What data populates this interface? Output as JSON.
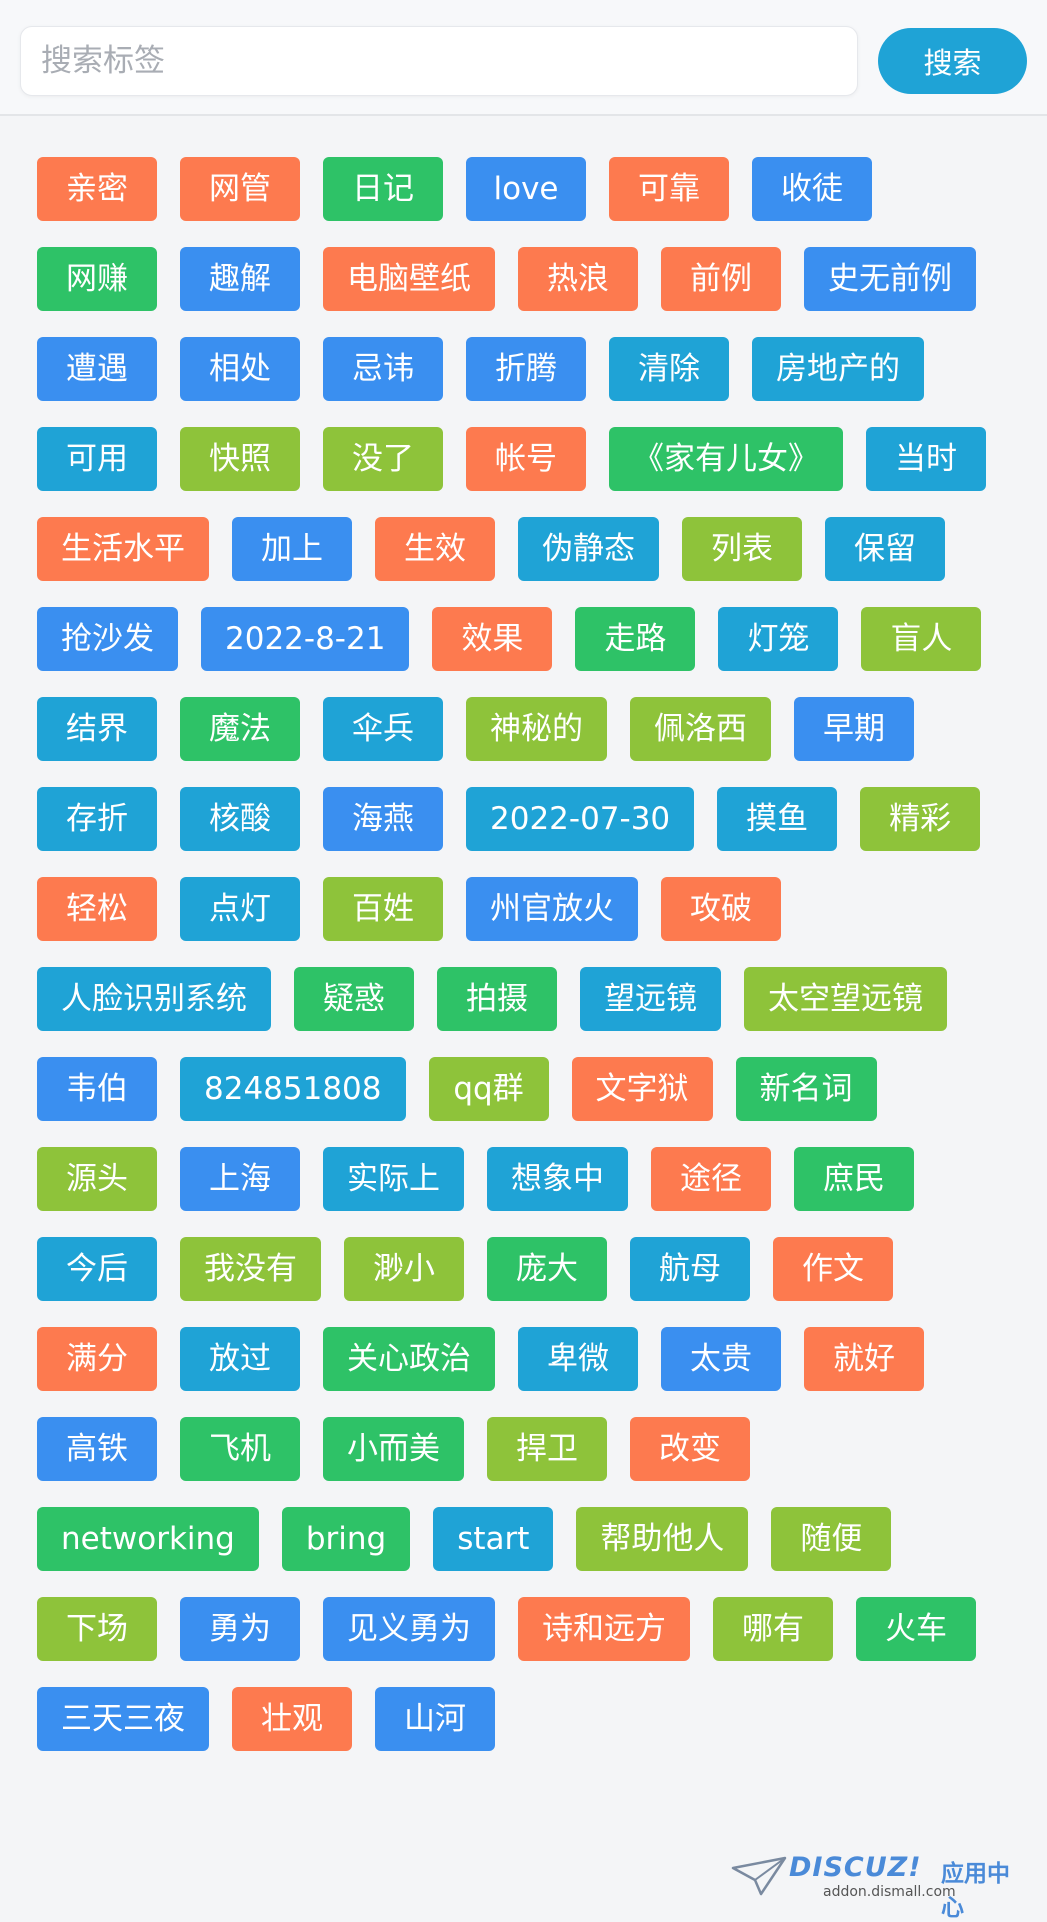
{
  "search": {
    "placeholder": "搜索标签",
    "button_label": "搜索"
  },
  "colors": {
    "orange": "#fd7a4f",
    "green": "#2ec267",
    "blue": "#3a8ff0",
    "teal": "#1fa3d6",
    "lime": "#8ec33a"
  },
  "tags": [
    {
      "label": "亲密",
      "color": "orange"
    },
    {
      "label": "网管",
      "color": "orange"
    },
    {
      "label": "日记",
      "color": "green"
    },
    {
      "label": "love",
      "color": "blue"
    },
    {
      "label": "可靠",
      "color": "orange"
    },
    {
      "label": "收徒",
      "color": "blue"
    },
    {
      "label": "网赚",
      "color": "green"
    },
    {
      "label": "趣解",
      "color": "blue"
    },
    {
      "label": "电脑壁纸",
      "color": "orange"
    },
    {
      "label": "热浪",
      "color": "orange"
    },
    {
      "label": "前例",
      "color": "orange"
    },
    {
      "label": "史无前例",
      "color": "blue"
    },
    {
      "label": "遭遇",
      "color": "blue"
    },
    {
      "label": "相处",
      "color": "blue"
    },
    {
      "label": "忌讳",
      "color": "blue"
    },
    {
      "label": "折腾",
      "color": "blue"
    },
    {
      "label": "清除",
      "color": "teal"
    },
    {
      "label": "房地产的",
      "color": "teal"
    },
    {
      "label": "可用",
      "color": "teal"
    },
    {
      "label": "快照",
      "color": "lime"
    },
    {
      "label": "没了",
      "color": "lime"
    },
    {
      "label": "帐号",
      "color": "orange"
    },
    {
      "label": "《家有儿女》",
      "color": "green"
    },
    {
      "label": "当时",
      "color": "teal"
    },
    {
      "label": "生活水平",
      "color": "orange"
    },
    {
      "label": "加上",
      "color": "blue"
    },
    {
      "label": "生效",
      "color": "orange"
    },
    {
      "label": "伪静态",
      "color": "teal"
    },
    {
      "label": "列表",
      "color": "lime"
    },
    {
      "label": "保留",
      "color": "teal"
    },
    {
      "label": "抢沙发",
      "color": "blue"
    },
    {
      "label": "2022-8-21",
      "color": "blue"
    },
    {
      "label": "效果",
      "color": "orange"
    },
    {
      "label": "走路",
      "color": "green"
    },
    {
      "label": "灯笼",
      "color": "teal"
    },
    {
      "label": "盲人",
      "color": "lime"
    },
    {
      "label": "结界",
      "color": "teal"
    },
    {
      "label": "魔法",
      "color": "green"
    },
    {
      "label": "伞兵",
      "color": "teal"
    },
    {
      "label": "神秘的",
      "color": "lime"
    },
    {
      "label": "佩洛西",
      "color": "lime"
    },
    {
      "label": "早期",
      "color": "blue"
    },
    {
      "label": "存折",
      "color": "teal"
    },
    {
      "label": "核酸",
      "color": "teal"
    },
    {
      "label": "海燕",
      "color": "blue"
    },
    {
      "label": "2022-07-30",
      "color": "teal"
    },
    {
      "label": "摸鱼",
      "color": "teal"
    },
    {
      "label": "精彩",
      "color": "lime"
    },
    {
      "label": "轻松",
      "color": "orange"
    },
    {
      "label": "点灯",
      "color": "teal"
    },
    {
      "label": "百姓",
      "color": "lime"
    },
    {
      "label": "州官放火",
      "color": "blue"
    },
    {
      "label": "攻破",
      "color": "orange"
    },
    {
      "label": "人脸识别系统",
      "color": "teal"
    },
    {
      "label": "疑惑",
      "color": "green"
    },
    {
      "label": "拍摄",
      "color": "green"
    },
    {
      "label": "望远镜",
      "color": "teal"
    },
    {
      "label": "太空望远镜",
      "color": "lime"
    },
    {
      "label": "韦伯",
      "color": "blue"
    },
    {
      "label": "824851808",
      "color": "teal"
    },
    {
      "label": "qq群",
      "color": "lime"
    },
    {
      "label": "文字狱",
      "color": "orange"
    },
    {
      "label": "新名词",
      "color": "green"
    },
    {
      "label": "源头",
      "color": "lime"
    },
    {
      "label": "上海",
      "color": "blue"
    },
    {
      "label": "实际上",
      "color": "teal"
    },
    {
      "label": "想象中",
      "color": "teal"
    },
    {
      "label": "途径",
      "color": "orange"
    },
    {
      "label": "庶民",
      "color": "green"
    },
    {
      "label": "今后",
      "color": "teal"
    },
    {
      "label": "我没有",
      "color": "lime"
    },
    {
      "label": "渺小",
      "color": "lime"
    },
    {
      "label": "庞大",
      "color": "green"
    },
    {
      "label": "航母",
      "color": "teal"
    },
    {
      "label": "作文",
      "color": "orange"
    },
    {
      "label": "满分",
      "color": "orange"
    },
    {
      "label": "放过",
      "color": "teal"
    },
    {
      "label": "关心政治",
      "color": "green"
    },
    {
      "label": "卑微",
      "color": "teal"
    },
    {
      "label": "太贵",
      "color": "blue"
    },
    {
      "label": "就好",
      "color": "orange"
    },
    {
      "label": "高铁",
      "color": "blue"
    },
    {
      "label": "飞机",
      "color": "green"
    },
    {
      "label": "小而美",
      "color": "green"
    },
    {
      "label": "捍卫",
      "color": "lime"
    },
    {
      "label": "改变",
      "color": "orange"
    },
    {
      "label": "networking",
      "color": "green"
    },
    {
      "label": "bring",
      "color": "green"
    },
    {
      "label": "start",
      "color": "teal"
    },
    {
      "label": "帮助他人",
      "color": "lime"
    },
    {
      "label": "随便",
      "color": "lime"
    },
    {
      "label": "下场",
      "color": "lime"
    },
    {
      "label": "勇为",
      "color": "blue"
    },
    {
      "label": "见义勇为",
      "color": "blue"
    },
    {
      "label": "诗和远方",
      "color": "orange"
    },
    {
      "label": "哪有",
      "color": "lime"
    },
    {
      "label": "火车",
      "color": "green"
    },
    {
      "label": "三天三夜",
      "color": "blue"
    },
    {
      "label": "壮观",
      "color": "orange"
    },
    {
      "label": "山河",
      "color": "blue"
    }
  ],
  "watermark": {
    "brand": "DISCUZ!",
    "brand_cn": "应用中心",
    "url": "addon.dismall.com"
  }
}
